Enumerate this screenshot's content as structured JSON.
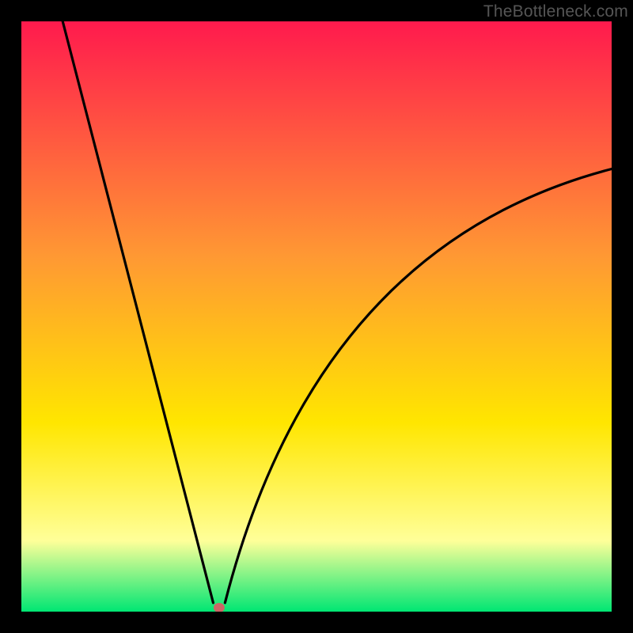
{
  "watermark": "TheBottleneck.com",
  "chart_data": {
    "type": "line",
    "title": "",
    "xlabel": "",
    "ylabel": "",
    "xlim": [
      0,
      100
    ],
    "ylim": [
      0,
      100
    ],
    "background_gradient": {
      "top": "#ff1a4d",
      "mid1": "#ff9933",
      "mid2": "#ffe600",
      "mid3": "#ffff99",
      "bottom": "#00e673"
    },
    "minimum_point": {
      "x": 33.5,
      "y": 0
    },
    "minimum_marker_color": "#cc6666",
    "curve_left": {
      "start": {
        "x": 7,
        "y": 100
      },
      "control": {
        "x": 24,
        "y": 35
      },
      "end": {
        "x": 32.5,
        "y": 1.5
      }
    },
    "curve_right": {
      "start": {
        "x": 34.5,
        "y": 1.5
      },
      "control": {
        "x": 50,
        "y": 62
      },
      "end": {
        "x": 100,
        "y": 75
      }
    },
    "series": [
      {
        "name": "curve",
        "x": [
          7,
          10,
          14,
          18,
          22,
          26,
          30,
          32.5,
          33.5,
          34.5,
          38,
          44,
          52,
          62,
          74,
          88,
          100
        ],
        "y": [
          100,
          87,
          72,
          57,
          42,
          27,
          12,
          1.5,
          0,
          1.5,
          13,
          28,
          42,
          54,
          63,
          70,
          75
        ]
      }
    ]
  }
}
